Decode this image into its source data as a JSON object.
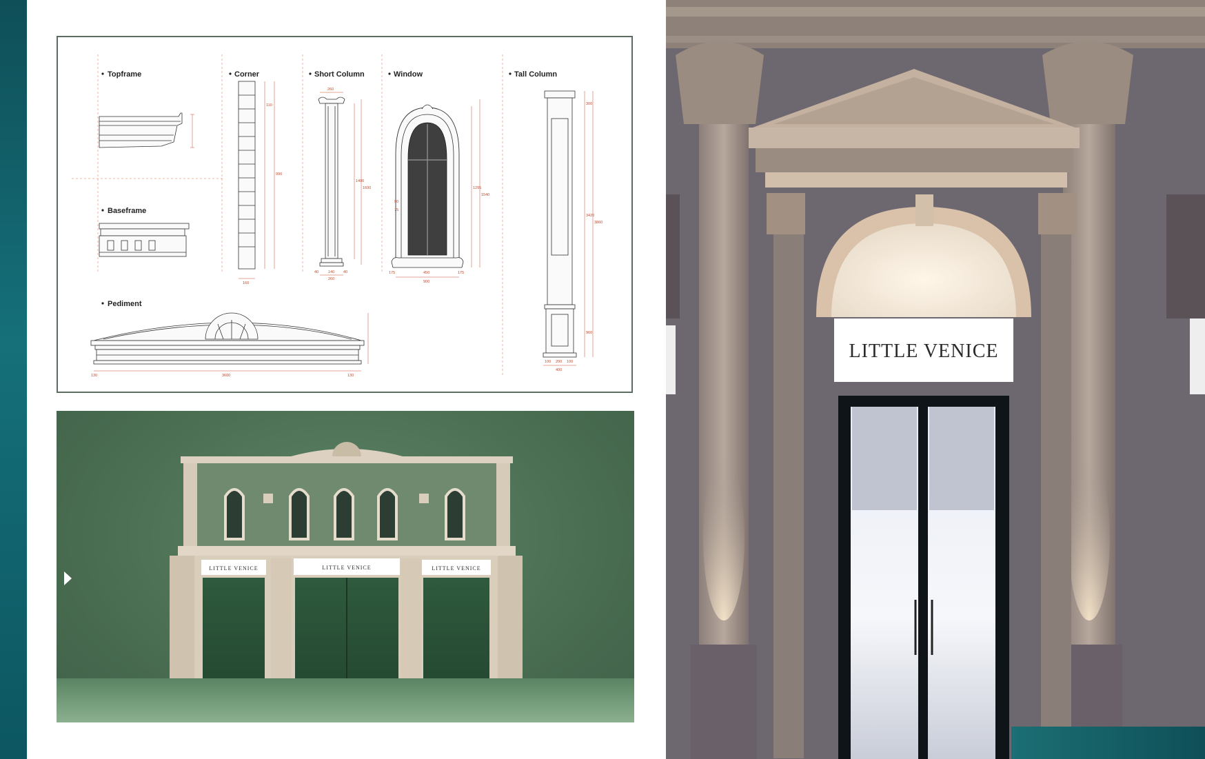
{
  "drawings": {
    "labels": {
      "topframe": "Topframe",
      "corner": "Corner",
      "short_column": "Short Column",
      "window": "Window",
      "tall_column": "Tall Column",
      "baseframe": "Baseframe",
      "pediment": "Pediment"
    },
    "dims": {
      "short_top": "260",
      "short_bottom": "220",
      "short_left": "40",
      "short_right": "40",
      "short_mid": "140",
      "short_height_a": "1400",
      "short_height_b": "1600",
      "window_width": "900",
      "window_inner": "450",
      "window_left": "175",
      "window_right": "175",
      "window_h1": "1295",
      "window_h2": "1540",
      "window_side_a": "90",
      "window_side_b": "75",
      "corner_width": "160",
      "corner_total": "990",
      "corner_seg": "110",
      "tall_bottom": "400",
      "tall_inner": "200",
      "tall_side": "100",
      "tall_h1": "3420",
      "tall_h2": "3860",
      "tall_h3": "300",
      "tall_h4": "960",
      "pediment_width": "3600",
      "pediment_left": "130",
      "pediment_right": "130"
    }
  },
  "render": {
    "sign_left": "LITTLE VENICE",
    "sign_center": "LITTLE VENICE",
    "sign_right": "LITTLE VENICE"
  },
  "photo": {
    "sign": "LITTLE VENICE"
  },
  "colors": {
    "teal": "#15707a",
    "green_bg": "#4a6e52",
    "stone": "#d9cdbb",
    "dim_red": "#c44b2d"
  }
}
